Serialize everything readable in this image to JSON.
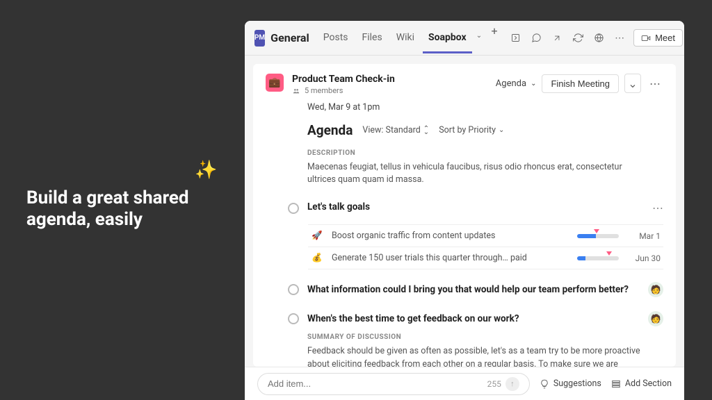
{
  "promo": {
    "line1": "Build a great shared",
    "line2": "agenda, easily"
  },
  "titlebar": {
    "pm_badge": "PM",
    "channel": "General",
    "tabs": [
      "Posts",
      "Files",
      "Wiki",
      "Soapbox"
    ],
    "active_tab_index": 3,
    "meet_label": "Meet"
  },
  "meeting": {
    "title": "Product Team Check-in",
    "members_text": "5 members",
    "agenda_dropdown": "Agenda",
    "finish_label": "Finish Meeting",
    "date": "Wed, Mar 9 at 1pm",
    "agenda_heading": "Agenda",
    "view_label": "View: Standard",
    "sort_label": "Sort by Priority",
    "description_label": "DESCRIPTION",
    "description_text": "Maecenas feugiat, tellus in vehicula faucibus, risus odio rhoncus erat, consectetur ultrices quam quam id massa."
  },
  "items": [
    {
      "title": "Let's talk goals",
      "goals": [
        {
          "emoji": "🚀",
          "text": "Boost organic traffic from content updates",
          "date": "Mar 1"
        },
        {
          "emoji": "💰",
          "text": "Generate 150 user trials this quarter through… paid",
          "date": "Jun 30"
        }
      ]
    },
    {
      "title": "What information could I bring you that would help our team perform better?"
    },
    {
      "title": "When's the best time to get feedback on our work?",
      "summary_label": "SUMMARY OF DISCUSSION",
      "summary": "Feedback should be given as often as possible, let's as a team try to be more proactive about eliciting feedback from each other on a regular basis. To make sure we are providing feedback let's meet once a week to discuss design progress."
    }
  ],
  "footer": {
    "placeholder": "Add item...",
    "char_count": "255",
    "suggestions": "Suggestions",
    "add_section": "Add Section"
  }
}
